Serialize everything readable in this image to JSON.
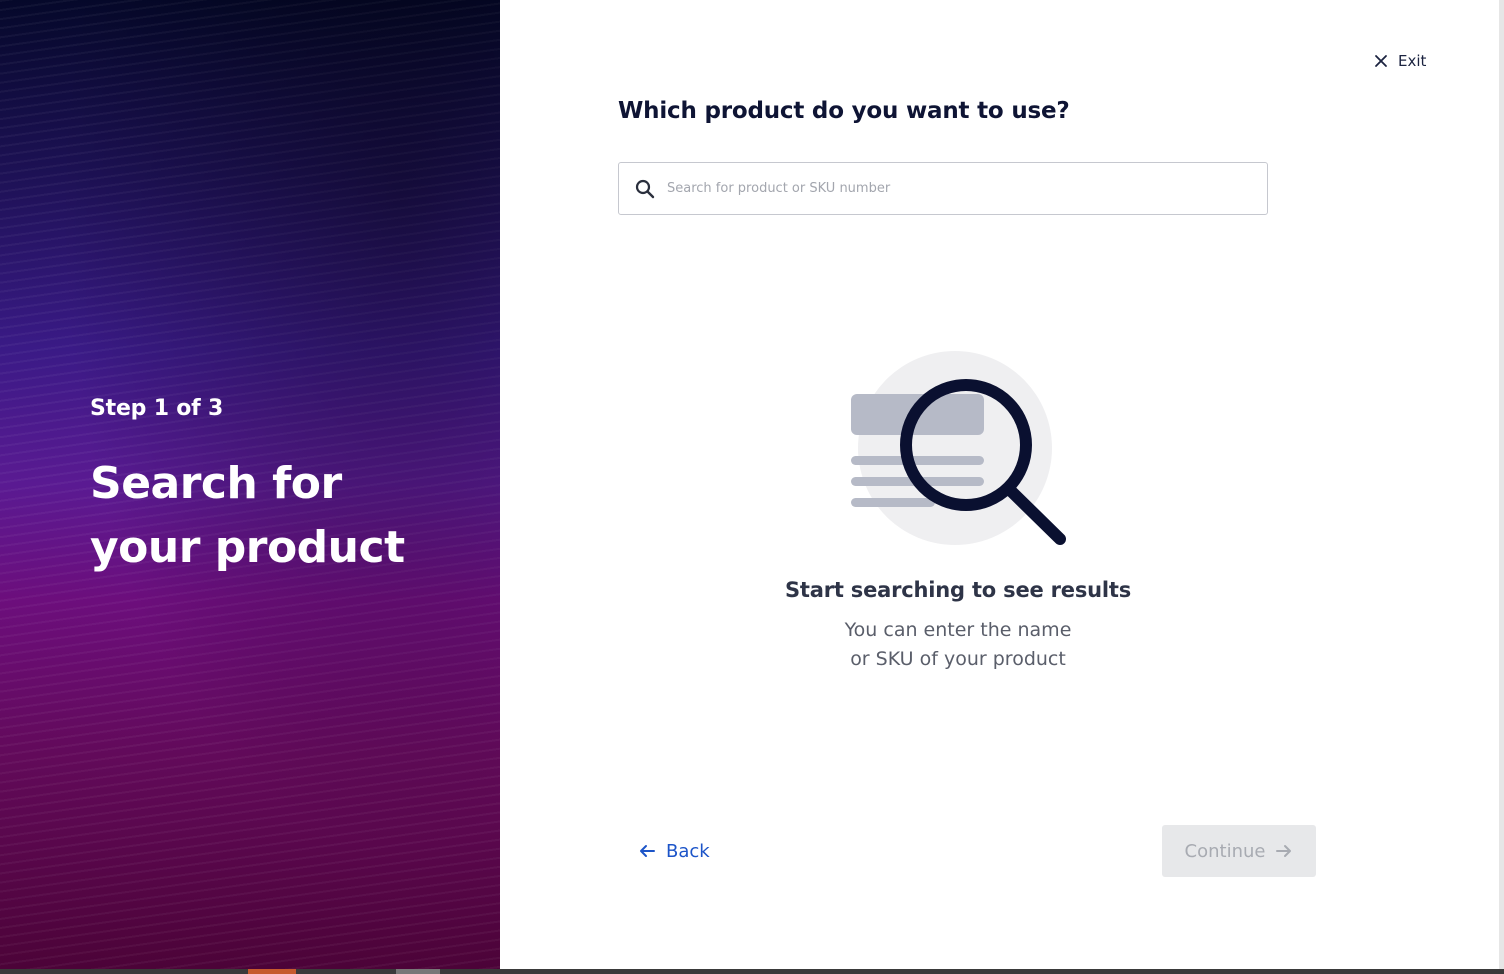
{
  "left_panel": {
    "step_label": "Step 1 of 3",
    "title": "Search for your product"
  },
  "header": {
    "exit_label": "Exit"
  },
  "main": {
    "question": "Which product do you want to use?",
    "search": {
      "placeholder": "Search for product or SKU number",
      "value": ""
    },
    "empty_state": {
      "title": "Start searching to see results",
      "description_line1": "You can enter the name",
      "description_line2": "or SKU of your product"
    }
  },
  "footer": {
    "back_label": "Back",
    "continue_label": "Continue",
    "continue_enabled": false
  },
  "colors": {
    "accent": "#1c54c8",
    "heading": "#0e1434",
    "disabled_bg": "#e7e8ea",
    "disabled_text": "#a8abb2"
  },
  "icons": [
    "close-icon",
    "search-icon",
    "magnifier-illustration",
    "arrow-left-icon",
    "arrow-right-icon"
  ]
}
